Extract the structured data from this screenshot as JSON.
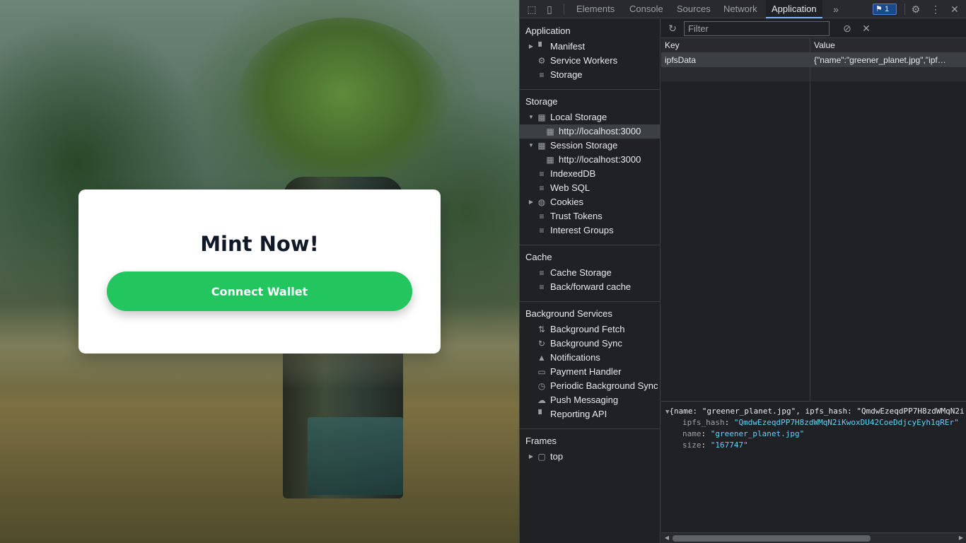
{
  "page": {
    "card": {
      "title": "Mint Now!",
      "button_label": "Connect Wallet"
    },
    "colors": {
      "button": "#22c55e",
      "card": "#ffffff"
    }
  },
  "devtools": {
    "tabs": [
      "Elements",
      "Console",
      "Sources",
      "Network",
      "Application"
    ],
    "active_tab": "Application",
    "issues_count": "1",
    "sidebar": {
      "application": {
        "title": "Application",
        "items": [
          "Manifest",
          "Service Workers",
          "Storage"
        ]
      },
      "storage": {
        "title": "Storage",
        "items": [
          "Local Storage",
          "http://localhost:3000",
          "Session Storage",
          "http://localhost:3000",
          "IndexedDB",
          "Web SQL",
          "Cookies",
          "Trust Tokens",
          "Interest Groups"
        ]
      },
      "cache": {
        "title": "Cache",
        "items": [
          "Cache Storage",
          "Back/forward cache"
        ]
      },
      "background": {
        "title": "Background Services",
        "items": [
          "Background Fetch",
          "Background Sync",
          "Notifications",
          "Payment Handler",
          "Periodic Background Sync",
          "Push Messaging",
          "Reporting API"
        ]
      },
      "frames": {
        "title": "Frames",
        "items": [
          "top"
        ]
      }
    },
    "filter": {
      "placeholder": "Filter"
    },
    "table": {
      "columns": [
        "Key",
        "Value"
      ],
      "rows": [
        {
          "key": "ipfsData",
          "value": "{\"name\":\"greener_planet.jpg\",\"ipf…"
        }
      ]
    },
    "preview": {
      "summary": "{name: \"greener_planet.jpg\", ipfs_hash: \"QmdwEzeqdPP7H8zdWMqN2i",
      "fields": [
        {
          "key": "ipfs_hash",
          "value": "\"QmdwEzeqdPP7H8zdWMqN2iKwoxDU42CoeDdjcyEyh1qREr\""
        },
        {
          "key": "name",
          "value": "\"greener_planet.jpg\""
        },
        {
          "key": "size",
          "value": "\"167747\""
        }
      ]
    }
  }
}
